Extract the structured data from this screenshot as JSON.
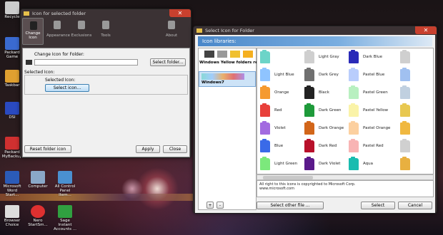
{
  "desktop": {
    "icons": [
      {
        "label": "Recycle"
      },
      {
        "label": "Packard Game"
      },
      {
        "label": "Taskbar"
      },
      {
        "label": "DSI"
      },
      {
        "label": "Packard MyBackup"
      },
      {
        "label": "Microsoft Word Start..."
      },
      {
        "label": "Computer"
      },
      {
        "label": "All Control Panel Item..."
      },
      {
        "label": "Browser Choice"
      },
      {
        "label": "Nero StartSm..."
      },
      {
        "label": "Sage Instant Accounts ..."
      }
    ]
  },
  "window1": {
    "title": "Icon for selected folder",
    "toolbar": [
      {
        "label": "Change Icon"
      },
      {
        "label": "Appearance"
      },
      {
        "label": "Exclusions"
      },
      {
        "label": "Tools"
      },
      {
        "label": "About"
      }
    ],
    "change_icon_label": "Change Icon for Folder:",
    "select_folder_button": "Select folder...",
    "selected_icon_group": "Selected Icon:",
    "selected_icon_label": "Selected Icon:",
    "select_icon_button": "Select icon...",
    "reset_button": "Reset folder icon",
    "apply_button": "Apply",
    "close_button": "Close"
  },
  "window2": {
    "title": "Select Icon for Folder",
    "libraries_label": "Icon libraries:",
    "libraries": [
      {
        "label": "Windows Yellow folders reborn"
      },
      {
        "label": "Windows7"
      }
    ],
    "folders": [
      {
        "label": "",
        "color": "#6cd4c8"
      },
      {
        "label": "Light Gray",
        "color": "#cfcfcf"
      },
      {
        "label": "Dark Blue",
        "color": "#2a2ab8"
      },
      {
        "label": "",
        "color": "#cfcfcf"
      },
      {
        "label": "Light Blue",
        "color": "#8fc4ff"
      },
      {
        "label": "Dark Grey",
        "color": "#707070"
      },
      {
        "label": "Pastel Blue",
        "color": "#b9cdfc"
      },
      {
        "label": "",
        "color": "#a0c0f0"
      },
      {
        "label": "Orange",
        "color": "#f59a30"
      },
      {
        "label": "Black",
        "color": "#222222"
      },
      {
        "label": "Pastel Green",
        "color": "#b8f0c0"
      },
      {
        "label": "",
        "color": "#c0d0e0"
      },
      {
        "label": "Red",
        "color": "#e8403a"
      },
      {
        "label": "Dark Green",
        "color": "#1e9a3a"
      },
      {
        "label": "Pastel Yellow",
        "color": "#faf3a8"
      },
      {
        "label": "",
        "color": "#e8c850"
      },
      {
        "label": "Violet",
        "color": "#a26ae0"
      },
      {
        "label": "Dark Orange",
        "color": "#d2661a"
      },
      {
        "label": "Pastel Orange",
        "color": "#fcd0a0"
      },
      {
        "label": "",
        "color": "#f0b840"
      },
      {
        "label": "Blue",
        "color": "#3a6ae8"
      },
      {
        "label": "Dark Red",
        "color": "#b8102a"
      },
      {
        "label": "Pastel Red",
        "color": "#f8b4b4"
      },
      {
        "label": "",
        "color": "#d0d0d0"
      },
      {
        "label": "Light Green",
        "color": "#7ce87c"
      },
      {
        "label": "Dark Violet",
        "color": "#5a1a8a"
      },
      {
        "label": "Aqua",
        "color": "#1abcb0"
      },
      {
        "label": "",
        "color": "#e8b040"
      }
    ],
    "copyright_lines": [
      "All right to this icons is copyrighted to Microsoft Corp.",
      "www.microsoft.com"
    ],
    "add_label": "+",
    "remove_label": "-",
    "select_other_button": "Select other file ...",
    "select_button": "Select",
    "cancel_button": "Cancel"
  }
}
